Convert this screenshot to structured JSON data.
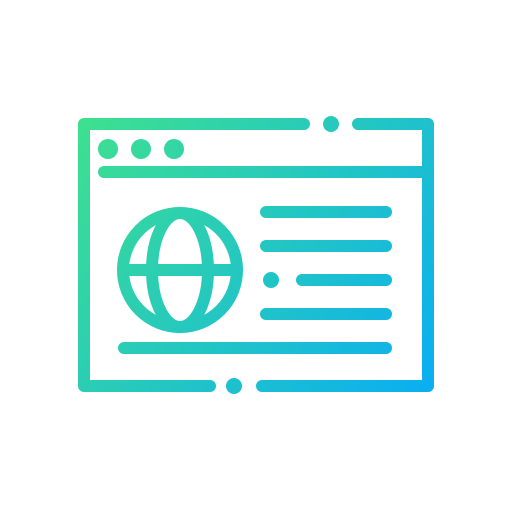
{
  "icon": {
    "name": "web-page-globe-icon",
    "style": "outline",
    "colors": {
      "gradient_start": "#3EE08F",
      "gradient_end": "#0AAEF2"
    }
  }
}
